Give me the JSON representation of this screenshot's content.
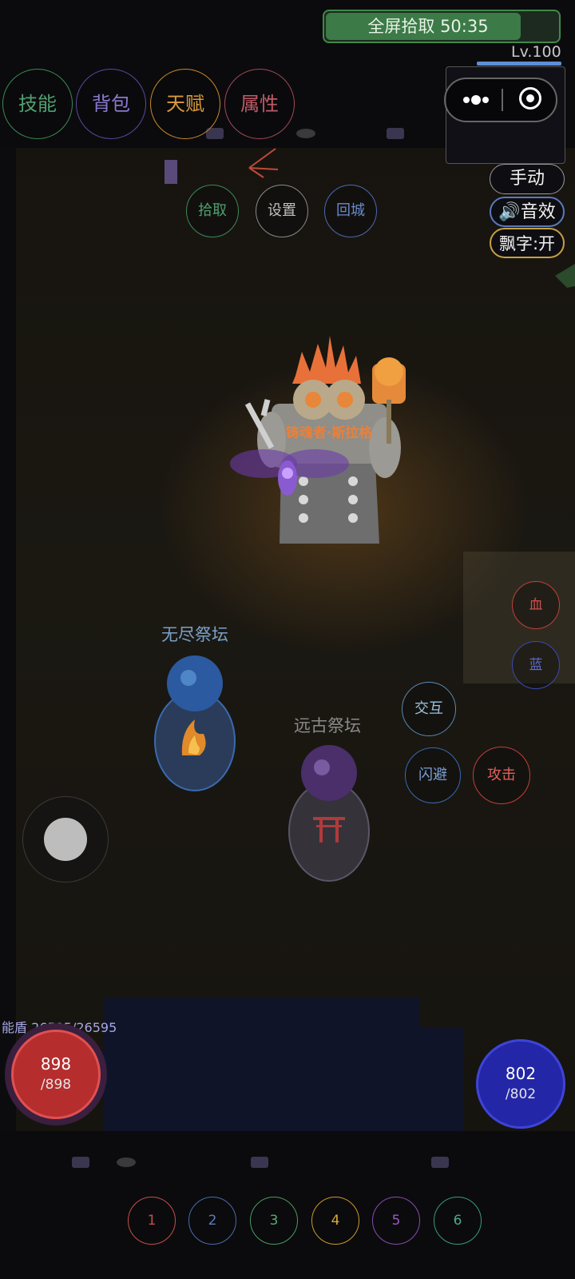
{
  "banner": {
    "label": "全屏拾取 50:35",
    "progress": 0.83
  },
  "level": "Lv.100",
  "menu": [
    "技能",
    "背包",
    "天赋",
    "属性"
  ],
  "actions": [
    "拾取",
    "设置",
    "回城"
  ],
  "toggles": {
    "mode": "手动",
    "sound": "🔊音效",
    "float_text": "飘字:开"
  },
  "boss": {
    "name": "铸魂者·斯拉格"
  },
  "altars": {
    "endless": "无尽祭坛",
    "ancient": "远古祭坛"
  },
  "side": {
    "hp_potion": "血",
    "mp_potion": "蓝"
  },
  "combat": {
    "interact": "交互",
    "dodge": "闪避",
    "attack": "攻击"
  },
  "shield": "能盾 26595/26595",
  "hp": {
    "value": "898",
    "max": "/898"
  },
  "mp": {
    "value": "802",
    "max": "/802"
  },
  "slots": [
    "1",
    "2",
    "3",
    "4",
    "5",
    "6"
  ],
  "colors": {
    "skill": "#3a8a55",
    "bag": "#5a4aa0",
    "talent": "#c9892a",
    "attr": "#a04a55",
    "slot1": "#c0504a",
    "slot2": "#4a6ab0",
    "slot3": "#4a9a60",
    "slot4": "#c9992a",
    "slot5": "#8a4ab0",
    "slot6": "#3a9a75"
  }
}
